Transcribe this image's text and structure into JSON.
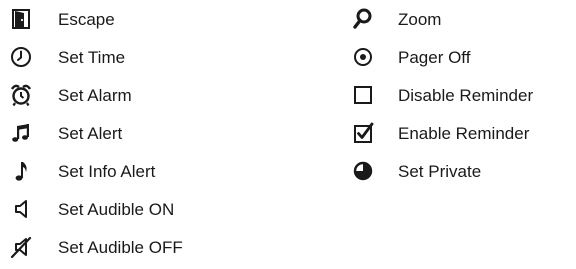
{
  "legend": {
    "left": [
      {
        "icon": "escape-door-icon",
        "label": "Escape"
      },
      {
        "icon": "clock-icon",
        "label": "Set Time"
      },
      {
        "icon": "alarm-clock-icon",
        "label": "Set Alarm"
      },
      {
        "icon": "double-note-icon",
        "label": "Set Alert"
      },
      {
        "icon": "single-note-icon",
        "label": "Set Info Alert"
      },
      {
        "icon": "speaker-icon",
        "label": "Set Audible ON"
      },
      {
        "icon": "speaker-muted-icon",
        "label": "Set Audible OFF"
      }
    ],
    "right": [
      {
        "icon": "magnifier-icon",
        "label": "Zoom"
      },
      {
        "icon": "target-dot-icon",
        "label": "Pager Off"
      },
      {
        "icon": "empty-checkbox-icon",
        "label": "Disable Reminder"
      },
      {
        "icon": "checked-checkbox-icon",
        "label": "Enable Reminder"
      },
      {
        "icon": "half-circle-icon",
        "label": "Set Private"
      }
    ]
  }
}
